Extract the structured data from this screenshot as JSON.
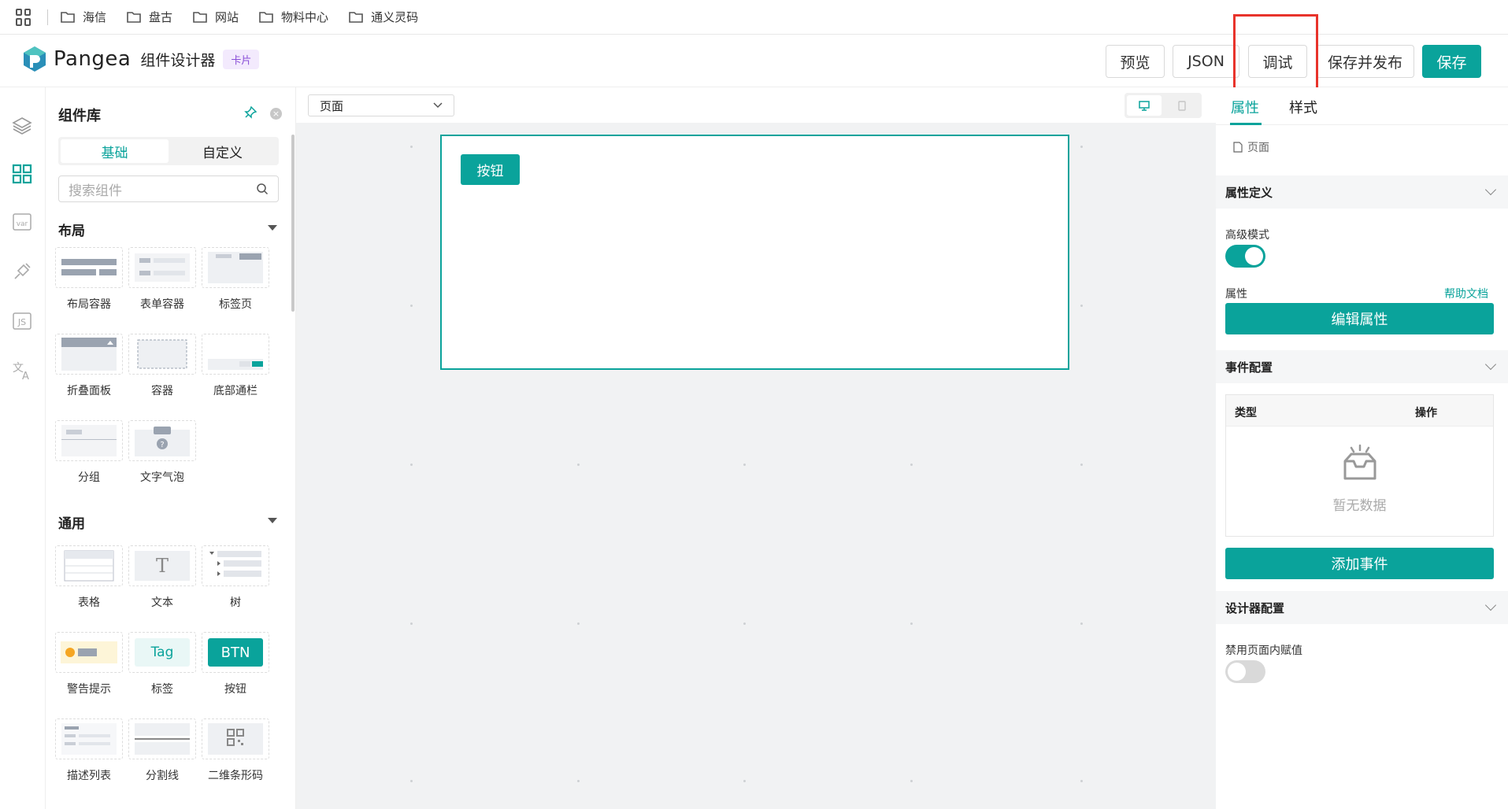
{
  "bookmarks": [
    {
      "label": "海信",
      "icon": "folder-icon"
    },
    {
      "label": "盘古",
      "icon": "folder-icon"
    },
    {
      "label": "网站",
      "icon": "folder-icon"
    },
    {
      "label": "物料中心",
      "icon": "folder-icon"
    },
    {
      "label": "通义灵码",
      "icon": "folder-icon"
    }
  ],
  "header": {
    "brand": "Pangea",
    "title": "组件设计器",
    "tag": "卡片",
    "buttons": {
      "preview": "预览",
      "json": "JSON",
      "debug": "调试",
      "save_publish": "保存并发布",
      "save": "保存"
    },
    "accent": "#0aa39b",
    "highlight_color": "#e8332b"
  },
  "iconbar": [
    "layers-icon",
    "components-grid-icon",
    "variables-icon",
    "plugin-icon",
    "js-icon",
    "translate-icon"
  ],
  "library": {
    "title": "组件库",
    "tabs": {
      "basic": "基础",
      "custom": "自定义"
    },
    "search_placeholder": "搜索组件",
    "categories": {
      "layout": "布局",
      "common": "通用"
    },
    "layout_items": [
      "布局容器",
      "表单容器",
      "标签页",
      "折叠面板",
      "容器",
      "底部通栏",
      "分组",
      "文字气泡"
    ],
    "common_items": [
      "表格",
      "文本",
      "树",
      "警告提示",
      "标签",
      "按钮",
      "描述列表",
      "分割线",
      "二维条形码"
    ],
    "thumb_text": {
      "text": "T",
      "tag": "Tag",
      "btn": "BTN"
    }
  },
  "canvas": {
    "page_select": "页面",
    "card_button": "按钮"
  },
  "props": {
    "tabs": {
      "attrs": "属性",
      "style": "样式"
    },
    "crumb": "页面",
    "sections": {
      "attr_def": "属性定义",
      "events": "事件配置",
      "designer": "设计器配置"
    },
    "advanced_mode": "高级模式",
    "attrs_label": "属性",
    "help_doc": "帮助文档",
    "edit_attrs": "编辑属性",
    "table_headers": {
      "type": "类型",
      "action": "操作"
    },
    "empty_text": "暂无数据",
    "add_event": "添加事件",
    "disable_assign": "禁用页面内赋值",
    "advanced_on": true,
    "disable_assign_on": false
  }
}
